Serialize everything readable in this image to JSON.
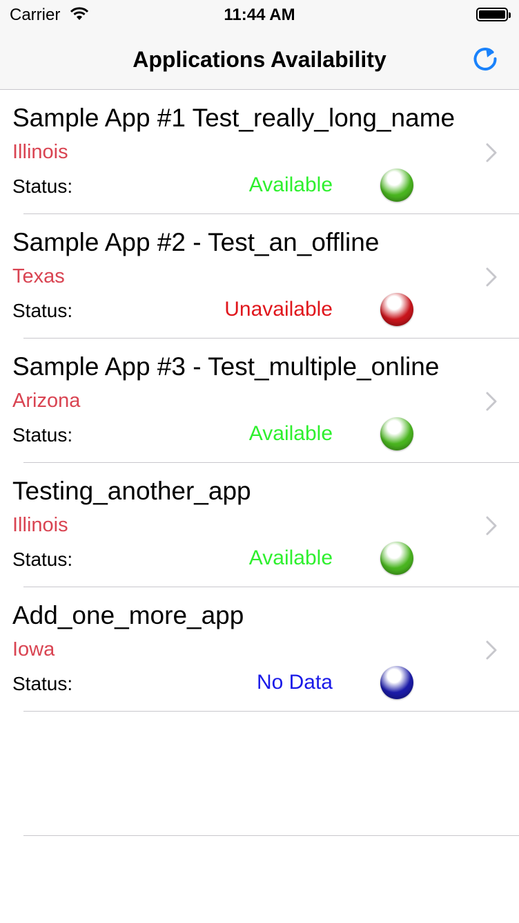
{
  "status_bar": {
    "carrier": "Carrier",
    "time": "11:44 AM"
  },
  "nav": {
    "title": "Applications Availability",
    "refresh_icon": "refresh-icon"
  },
  "colors": {
    "accent": "#1a82fb",
    "location": "#d94452",
    "available": "#2ef02e",
    "unavailable": "#e0161c",
    "no_data": "#1a1ae8",
    "orb_green": "#4ab520",
    "orb_red": "#c8151c",
    "orb_blue": "#1c1ca8"
  },
  "apps": [
    {
      "title": "Sample App #1 Test_really_long_name",
      "location": "Illinois",
      "status_label": "Status:",
      "status": "Available",
      "state": "available"
    },
    {
      "title": "Sample App #2 - Test_an_offline",
      "location": "Texas",
      "status_label": "Status:",
      "status": "Unavailable",
      "state": "unavailable"
    },
    {
      "title": "Sample App #3 - Test_multiple_online",
      "location": "Arizona",
      "status_label": "Status:",
      "status": "Available",
      "state": "available"
    },
    {
      "title": "Testing_another_app",
      "location": "Illinois",
      "status_label": "Status:",
      "status": "Available",
      "state": "available"
    },
    {
      "title": "Add_one_more_app",
      "location": "Iowa",
      "status_label": "Status:",
      "status": "No Data",
      "state": "no_data"
    }
  ]
}
